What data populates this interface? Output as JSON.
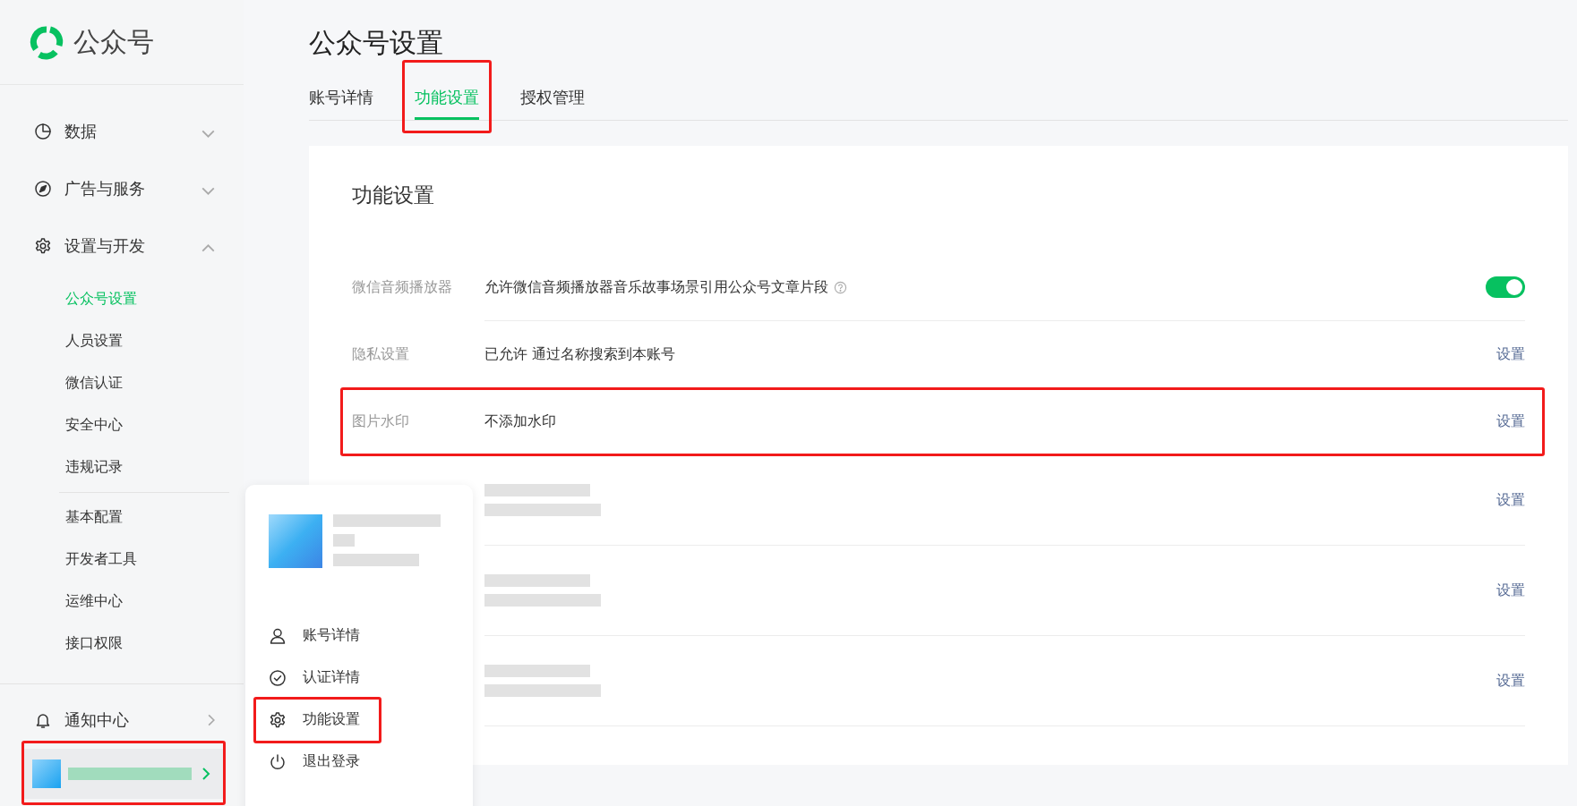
{
  "sidebar": {
    "logo_text": "公众号",
    "menu": [
      {
        "label": "数据",
        "expanded": false
      },
      {
        "label": "广告与服务",
        "expanded": false
      },
      {
        "label": "设置与开发",
        "expanded": true,
        "groups": [
          {
            "items": [
              {
                "label": "公众号设置",
                "selected": true
              },
              {
                "label": "人员设置",
                "selected": false
              },
              {
                "label": "微信认证",
                "selected": false
              },
              {
                "label": "安全中心",
                "selected": false
              },
              {
                "label": "违规记录",
                "selected": false
              }
            ]
          },
          {
            "items": [
              {
                "label": "基本配置",
                "selected": false
              },
              {
                "label": "开发者工具",
                "selected": false
              },
              {
                "label": "运维中心",
                "selected": false
              },
              {
                "label": "接口权限",
                "selected": false
              }
            ]
          }
        ]
      }
    ],
    "notifications": {
      "label": "通知中心"
    },
    "account": {
      "highlighted": true
    }
  },
  "page": {
    "title": "公众号设置",
    "tabs": [
      {
        "label": "账号详情",
        "selected": false,
        "highlighted": false
      },
      {
        "label": "功能设置",
        "selected": true,
        "highlighted": true
      },
      {
        "label": "授权管理",
        "selected": false,
        "highlighted": false
      }
    ],
    "card": {
      "title": "功能设置",
      "rows": [
        {
          "kind": "toggle",
          "label": "微信音频播放器",
          "value": "允许微信音频播放器音乐故事场景引用公众号文章片段",
          "help": true,
          "on": true,
          "highlighted": false
        },
        {
          "kind": "link",
          "label": "隐私设置",
          "value": "已允许 通过名称搜索到本账号",
          "action": "设置",
          "highlighted": false
        },
        {
          "kind": "link",
          "label": "图片水印",
          "value": "不添加水印",
          "action": "设置",
          "highlighted": true
        },
        {
          "kind": "link",
          "redacted": true,
          "action": "设置",
          "highlighted": false
        },
        {
          "kind": "link",
          "redacted": true,
          "action": "设置",
          "highlighted": false
        },
        {
          "kind": "link",
          "redacted": true,
          "action": "设置",
          "highlighted": false
        }
      ]
    }
  },
  "account_menu": {
    "items": [
      {
        "label": "账号详情",
        "highlighted": false
      },
      {
        "label": "认证详情",
        "highlighted": false
      },
      {
        "label": "功能设置",
        "highlighted": true
      },
      {
        "label": "退出登录",
        "highlighted": false
      }
    ]
  }
}
